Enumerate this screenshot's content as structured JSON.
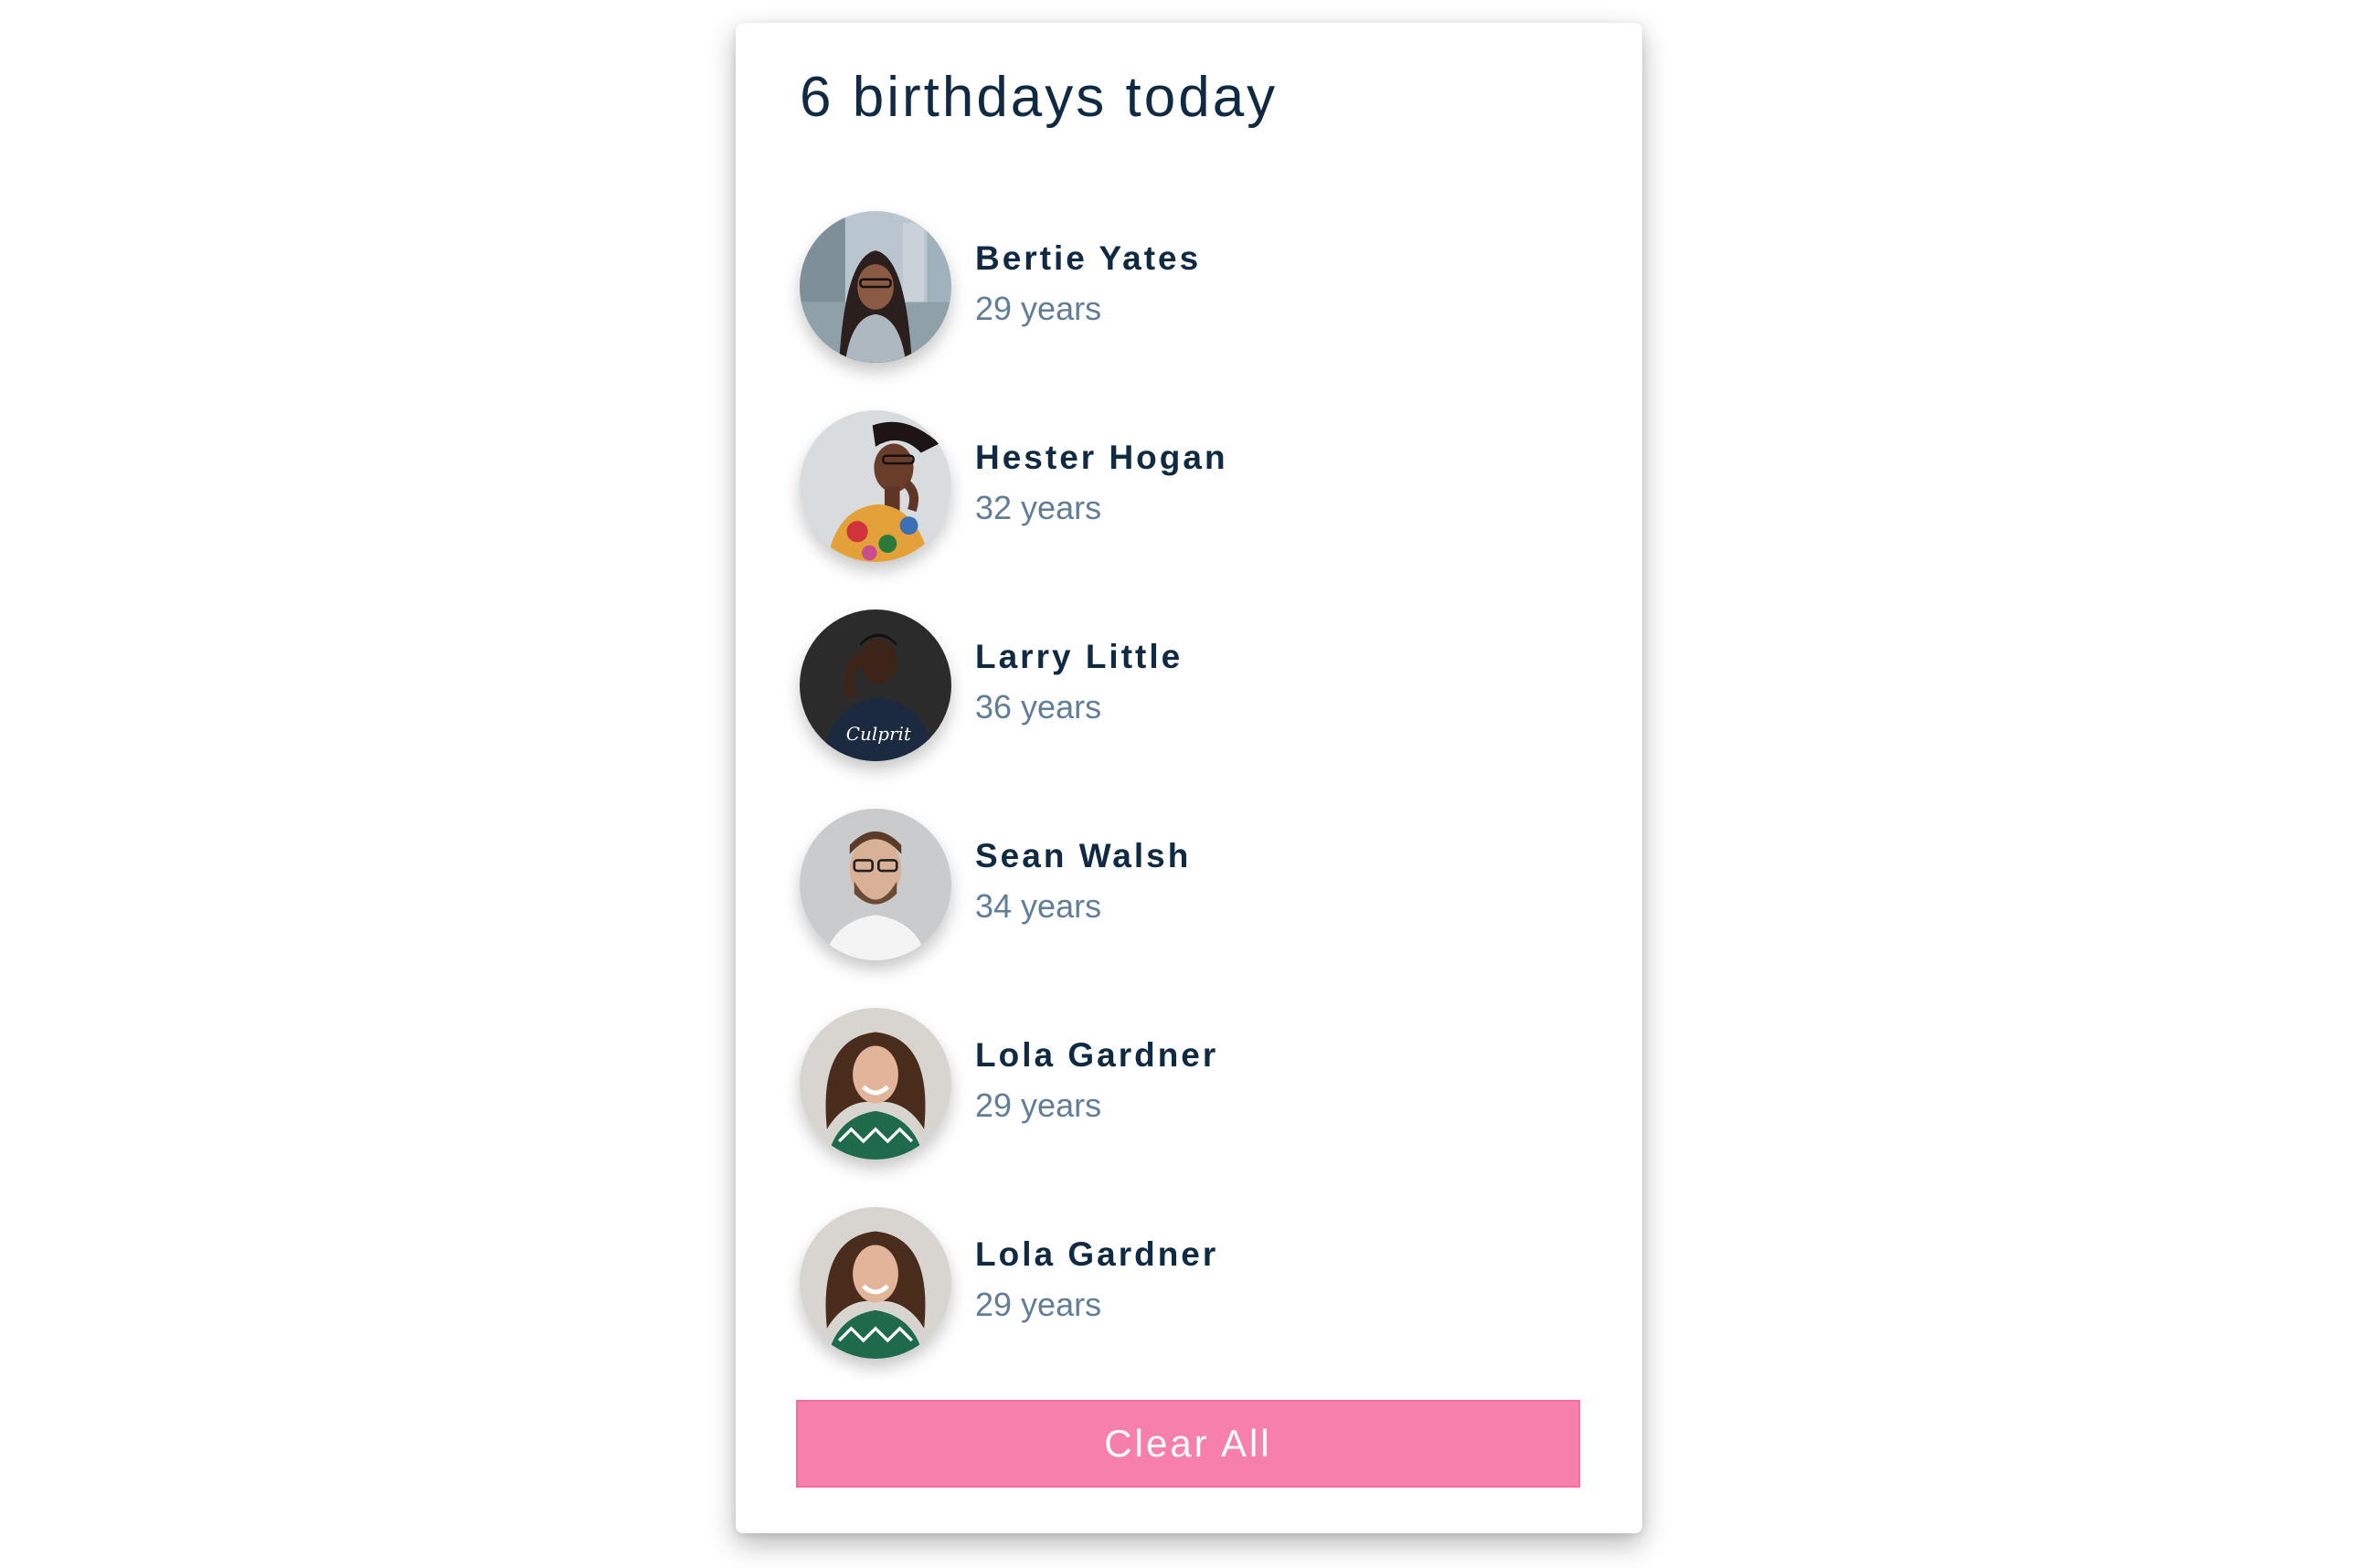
{
  "header": {
    "title": "6 birthdays today"
  },
  "people": [
    {
      "name": "Bertie Yates",
      "age": "29 years",
      "avatar": "avatar-woman-glasses-street"
    },
    {
      "name": "Hester Hogan",
      "age": "32 years",
      "avatar": "avatar-woman-headwrap-glasses"
    },
    {
      "name": "Larry Little",
      "age": "36 years",
      "avatar": "avatar-man-dark-tshirt"
    },
    {
      "name": "Sean Walsh",
      "age": "34 years",
      "avatar": "avatar-man-beard-glasses"
    },
    {
      "name": "Lola Gardner",
      "age": "29 years",
      "avatar": "avatar-woman-curly-hair"
    },
    {
      "name": "Lola Gardner",
      "age": "29 years",
      "avatar": "avatar-woman-curly-hair"
    }
  ],
  "actions": {
    "clear_label": "Clear All"
  },
  "colors": {
    "heading": "#102a43",
    "subtext": "#627d98",
    "button": "#f77fab",
    "background": "#ffffff"
  }
}
